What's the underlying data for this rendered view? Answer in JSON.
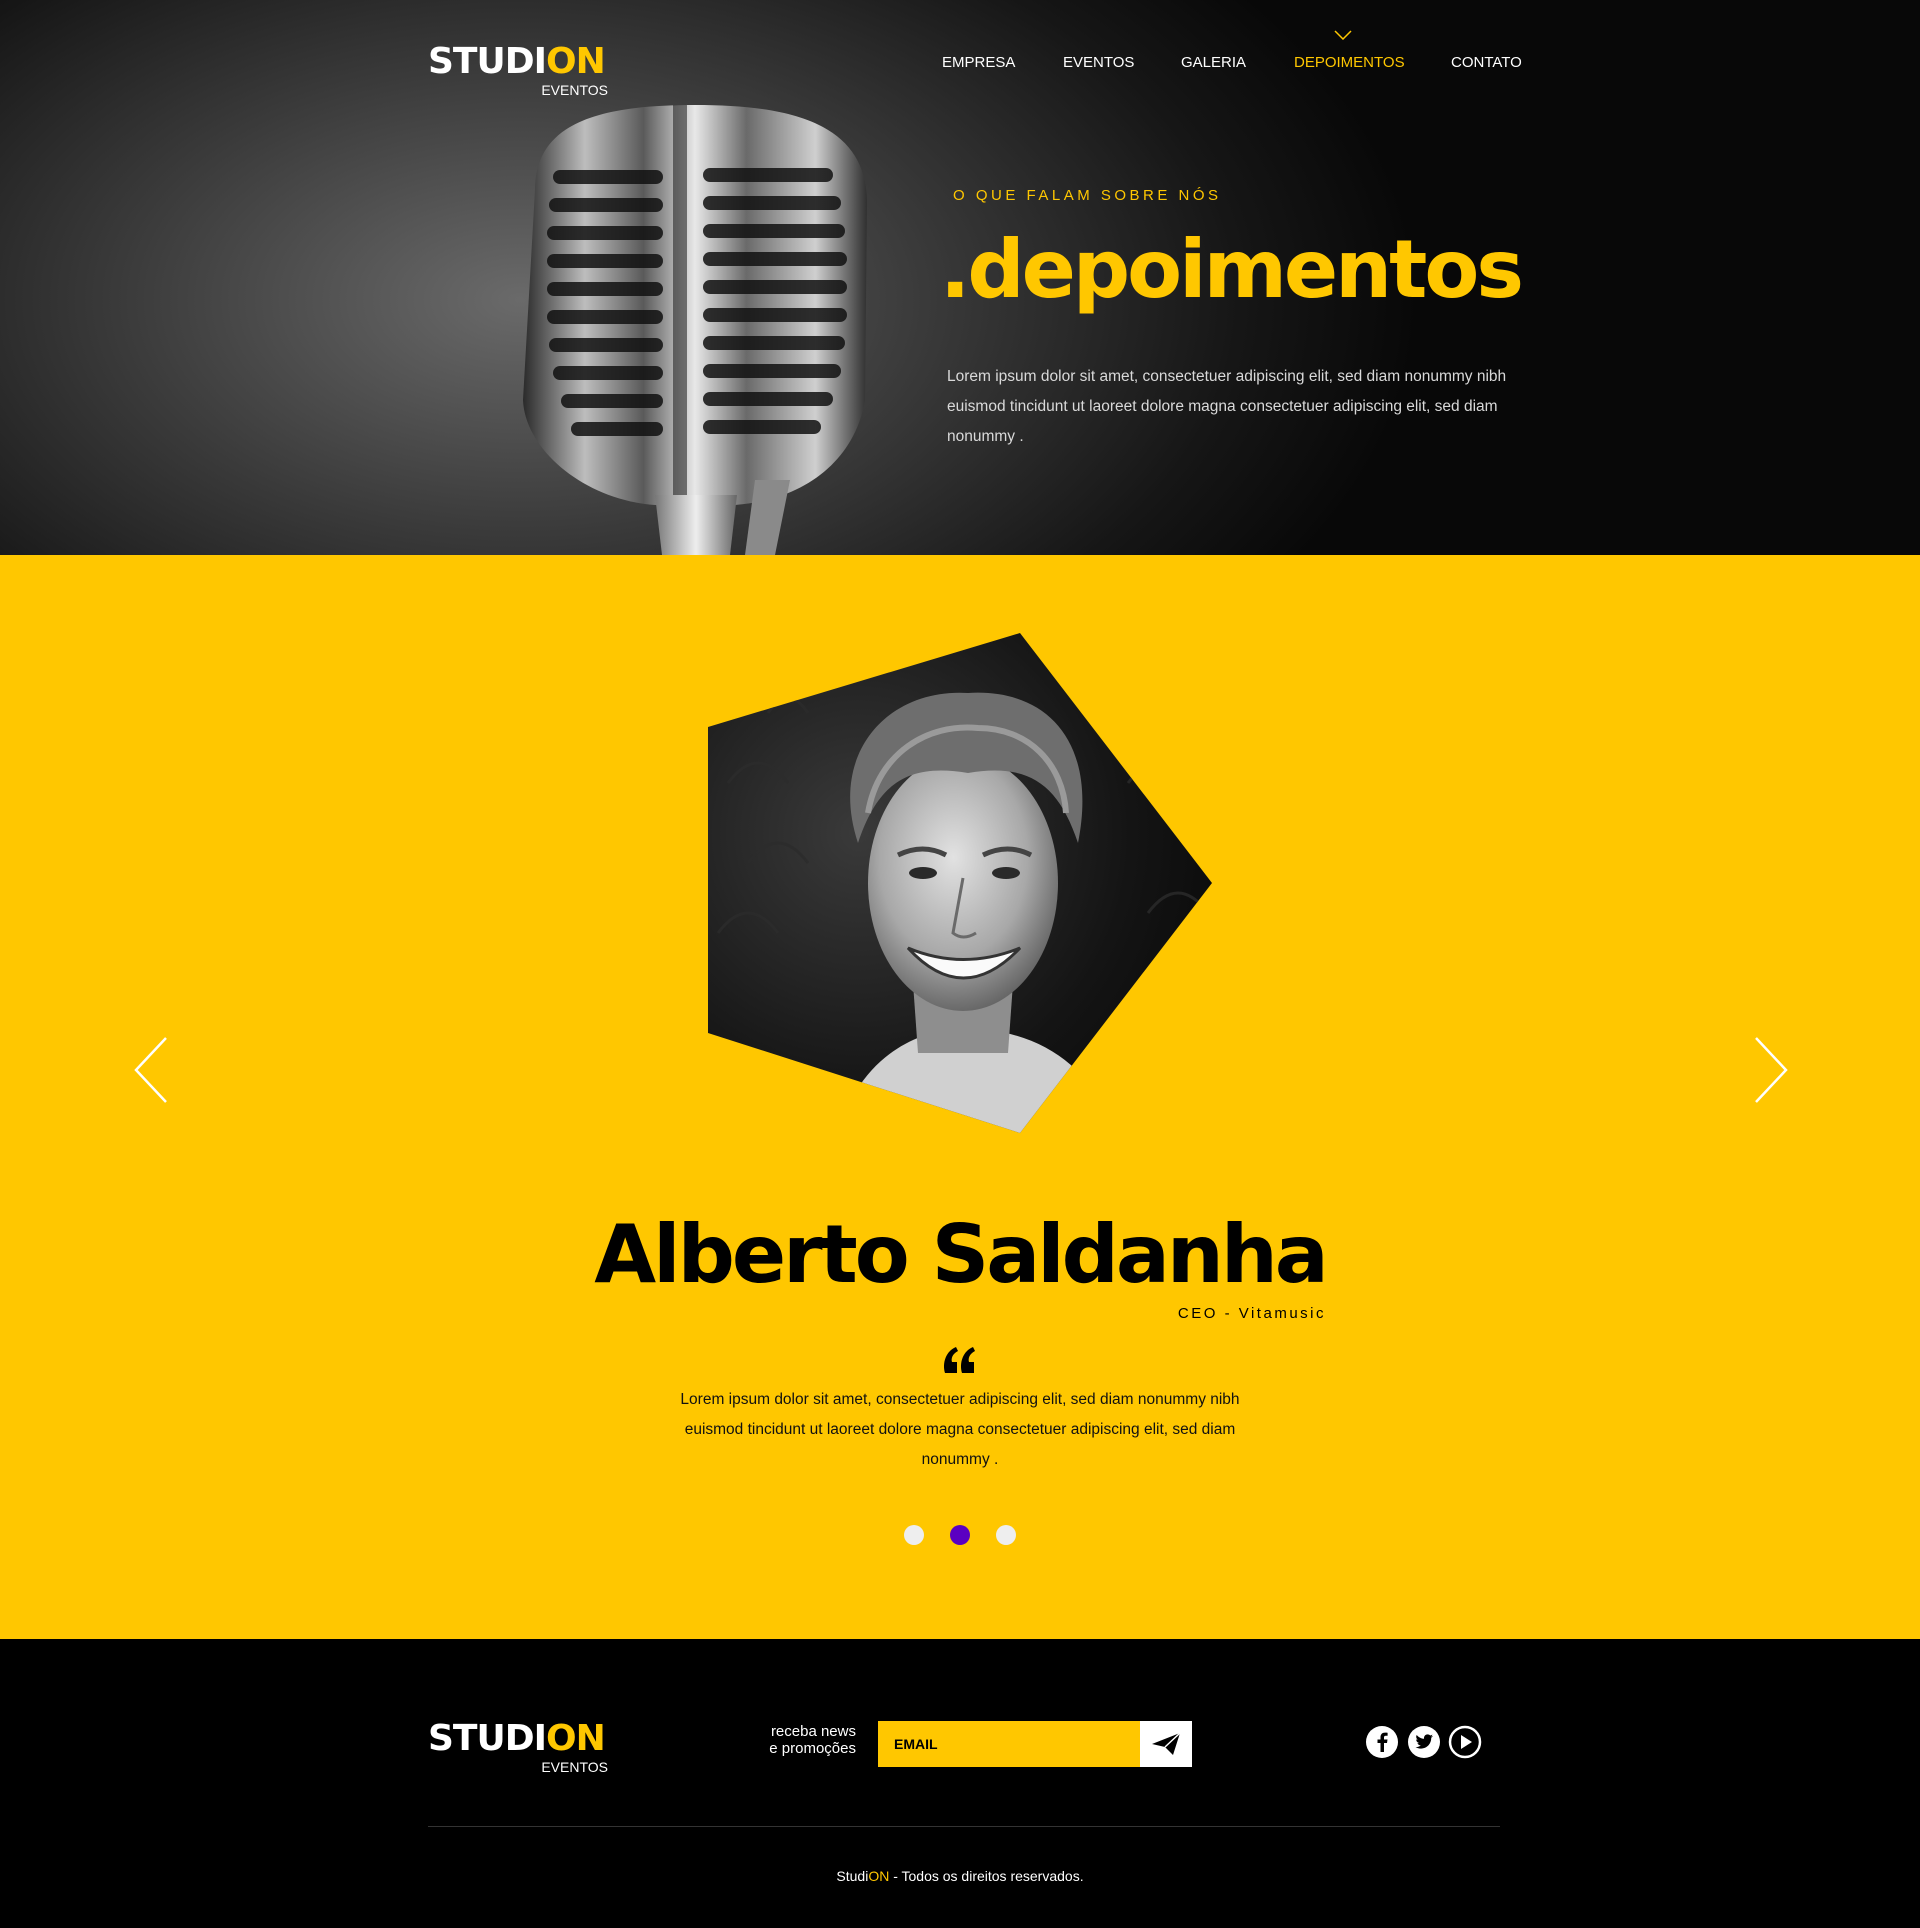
{
  "brand": {
    "name_prefix": "STUDI",
    "name_suffix": "ON",
    "tagline": "EVENTOS"
  },
  "nav": {
    "items": [
      {
        "label": "EMPRESA"
      },
      {
        "label": "EVENTOS"
      },
      {
        "label": "GALERIA"
      },
      {
        "label": "DEPOIMENTOS"
      },
      {
        "label": "CONTATO"
      }
    ],
    "active_index": 3
  },
  "hero": {
    "kicker": "O QUE FALAM SOBRE NÓS",
    "title": ".depoimentos",
    "description": "Lorem ipsum dolor sit amet, consectetuer adipiscing elit, sed diam nonummy nibh euismod tincidunt ut laoreet dolore magna consectetuer adipiscing elit, sed diam nonummy ."
  },
  "testimonial": {
    "name": "Alberto Saldanha",
    "role": "CEO - Vitamusic",
    "quote": "Lorem ipsum dolor sit amet, consectetuer adipiscing elit, sed diam nonummy nibh euismod tincidunt ut laoreet dolore magna consectetuer adipiscing elit, sed diam nonummy .",
    "slide_count": 3,
    "active_slide": 1
  },
  "footer": {
    "newsletter_label_line1": "receba news",
    "newsletter_label_line2": "e promoções",
    "email_placeholder": "EMAIL",
    "social_icons": [
      "facebook-icon",
      "twitter-icon",
      "youtube-icon"
    ],
    "copyright_prefix": "Studi",
    "copyright_suffix": "ON",
    "copyright_text": " - Todos os direitos reservados."
  },
  "colors": {
    "accent": "#ffc700",
    "dark": "#000000",
    "active_dot": "#5b00c2",
    "inactive_dot": "#eeeeee"
  }
}
